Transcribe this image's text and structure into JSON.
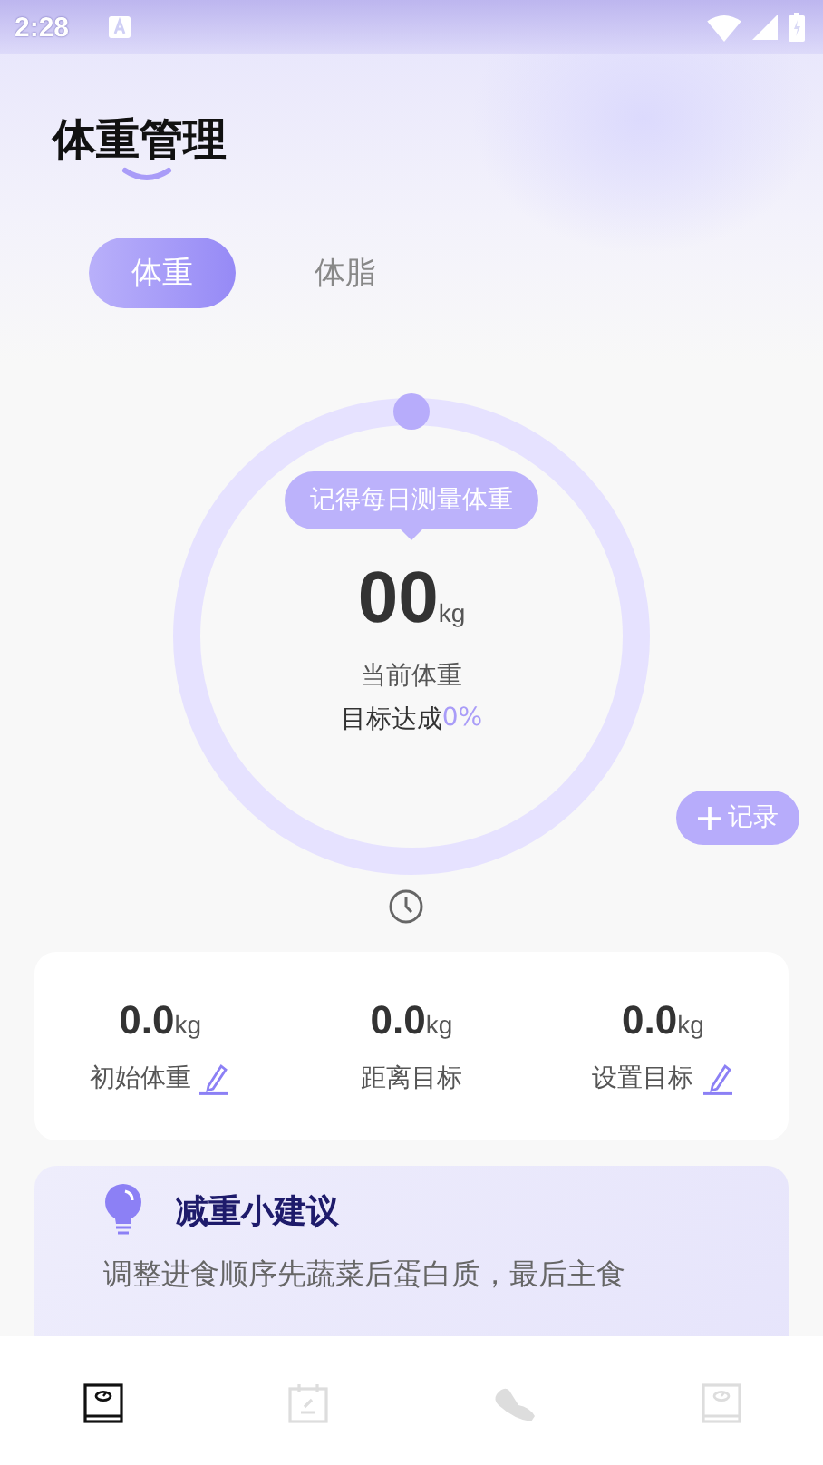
{
  "status_bar": {
    "time": "2:28"
  },
  "title": "体重管理",
  "tabs": [
    {
      "label": "体重",
      "selected": true
    },
    {
      "label": "体脂",
      "selected": false
    }
  ],
  "ring": {
    "bubble": "记得每日测量体重",
    "value": "00",
    "unit": "kg",
    "caption": "当前体重",
    "goal_label": "目标达成",
    "goal_value": "0%"
  },
  "record_button": {
    "label": "记录"
  },
  "stats": [
    {
      "value": "0.0",
      "unit": "kg",
      "label": "初始体重",
      "editable": true
    },
    {
      "value": "0.0",
      "unit": "kg",
      "label": "距离目标",
      "editable": false
    },
    {
      "value": "0.0",
      "unit": "kg",
      "label": "设置目标",
      "editable": true
    }
  ],
  "tip": {
    "title": "减重小建议",
    "text": "调整进食顺序先蔬菜后蛋白质，最后主食"
  },
  "nav": [
    {
      "kind": "scale",
      "selected": true
    },
    {
      "kind": "calendar",
      "selected": false
    },
    {
      "kind": "shoe",
      "selected": false
    },
    {
      "kind": "scale",
      "selected": false
    }
  ]
}
